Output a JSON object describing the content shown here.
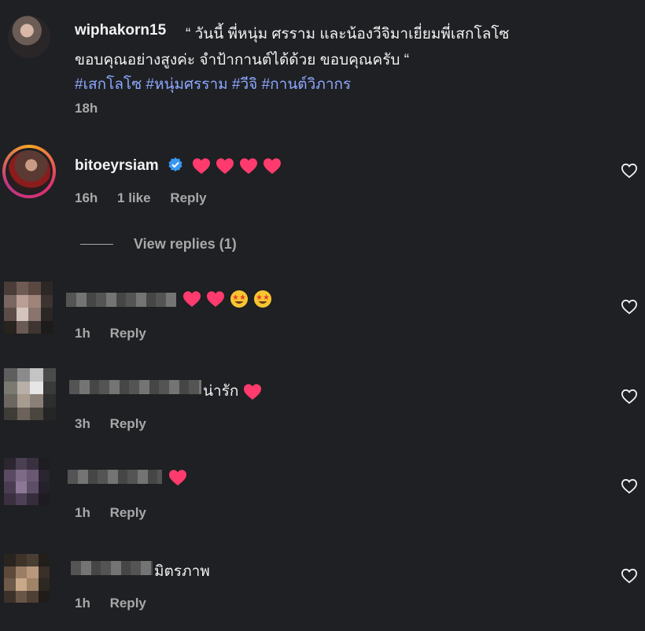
{
  "post": {
    "username": "wiphakorn15",
    "caption_line1": "“ วันนี้ พี่หนุ่ม ศรราม และน้องวีจิมาเยี่ยมพี่เสกโลโซ",
    "caption_line2": "ขอบคุณอย่างสูงค่ะ จำป้ากานต์ได้ด้วย ขอบคุณครับ “",
    "hashtags": "#เสกโลโซ #หนุ่มศรราม #วีจิ #กานต์วิภากร",
    "time": "18h"
  },
  "comments": [
    {
      "username": "bitoeyrsiam",
      "verified": true,
      "hearts": 4,
      "time": "16h",
      "likes": "1 like",
      "reply_label": "Reply"
    }
  ],
  "view_replies_label": "View replies (1)",
  "replies": [
    {
      "text": "",
      "time": "1h",
      "reply_label": "Reply",
      "emojis": [
        "heart",
        "heart",
        "star-struck",
        "star-struck"
      ]
    },
    {
      "text": "น่ารัก",
      "time": "3h",
      "reply_label": "Reply",
      "emojis": [
        "heart"
      ]
    },
    {
      "text": "",
      "time": "1h",
      "reply_label": "Reply",
      "emojis": [
        "heart"
      ]
    },
    {
      "text": "มิตรภาพ",
      "time": "1h",
      "reply_label": "Reply",
      "emojis": []
    }
  ],
  "colors": {
    "background": "#1e2023",
    "hashtag": "#8ea8ff",
    "verified_badge": "#3897f0",
    "heart": "#ff3b6e"
  }
}
